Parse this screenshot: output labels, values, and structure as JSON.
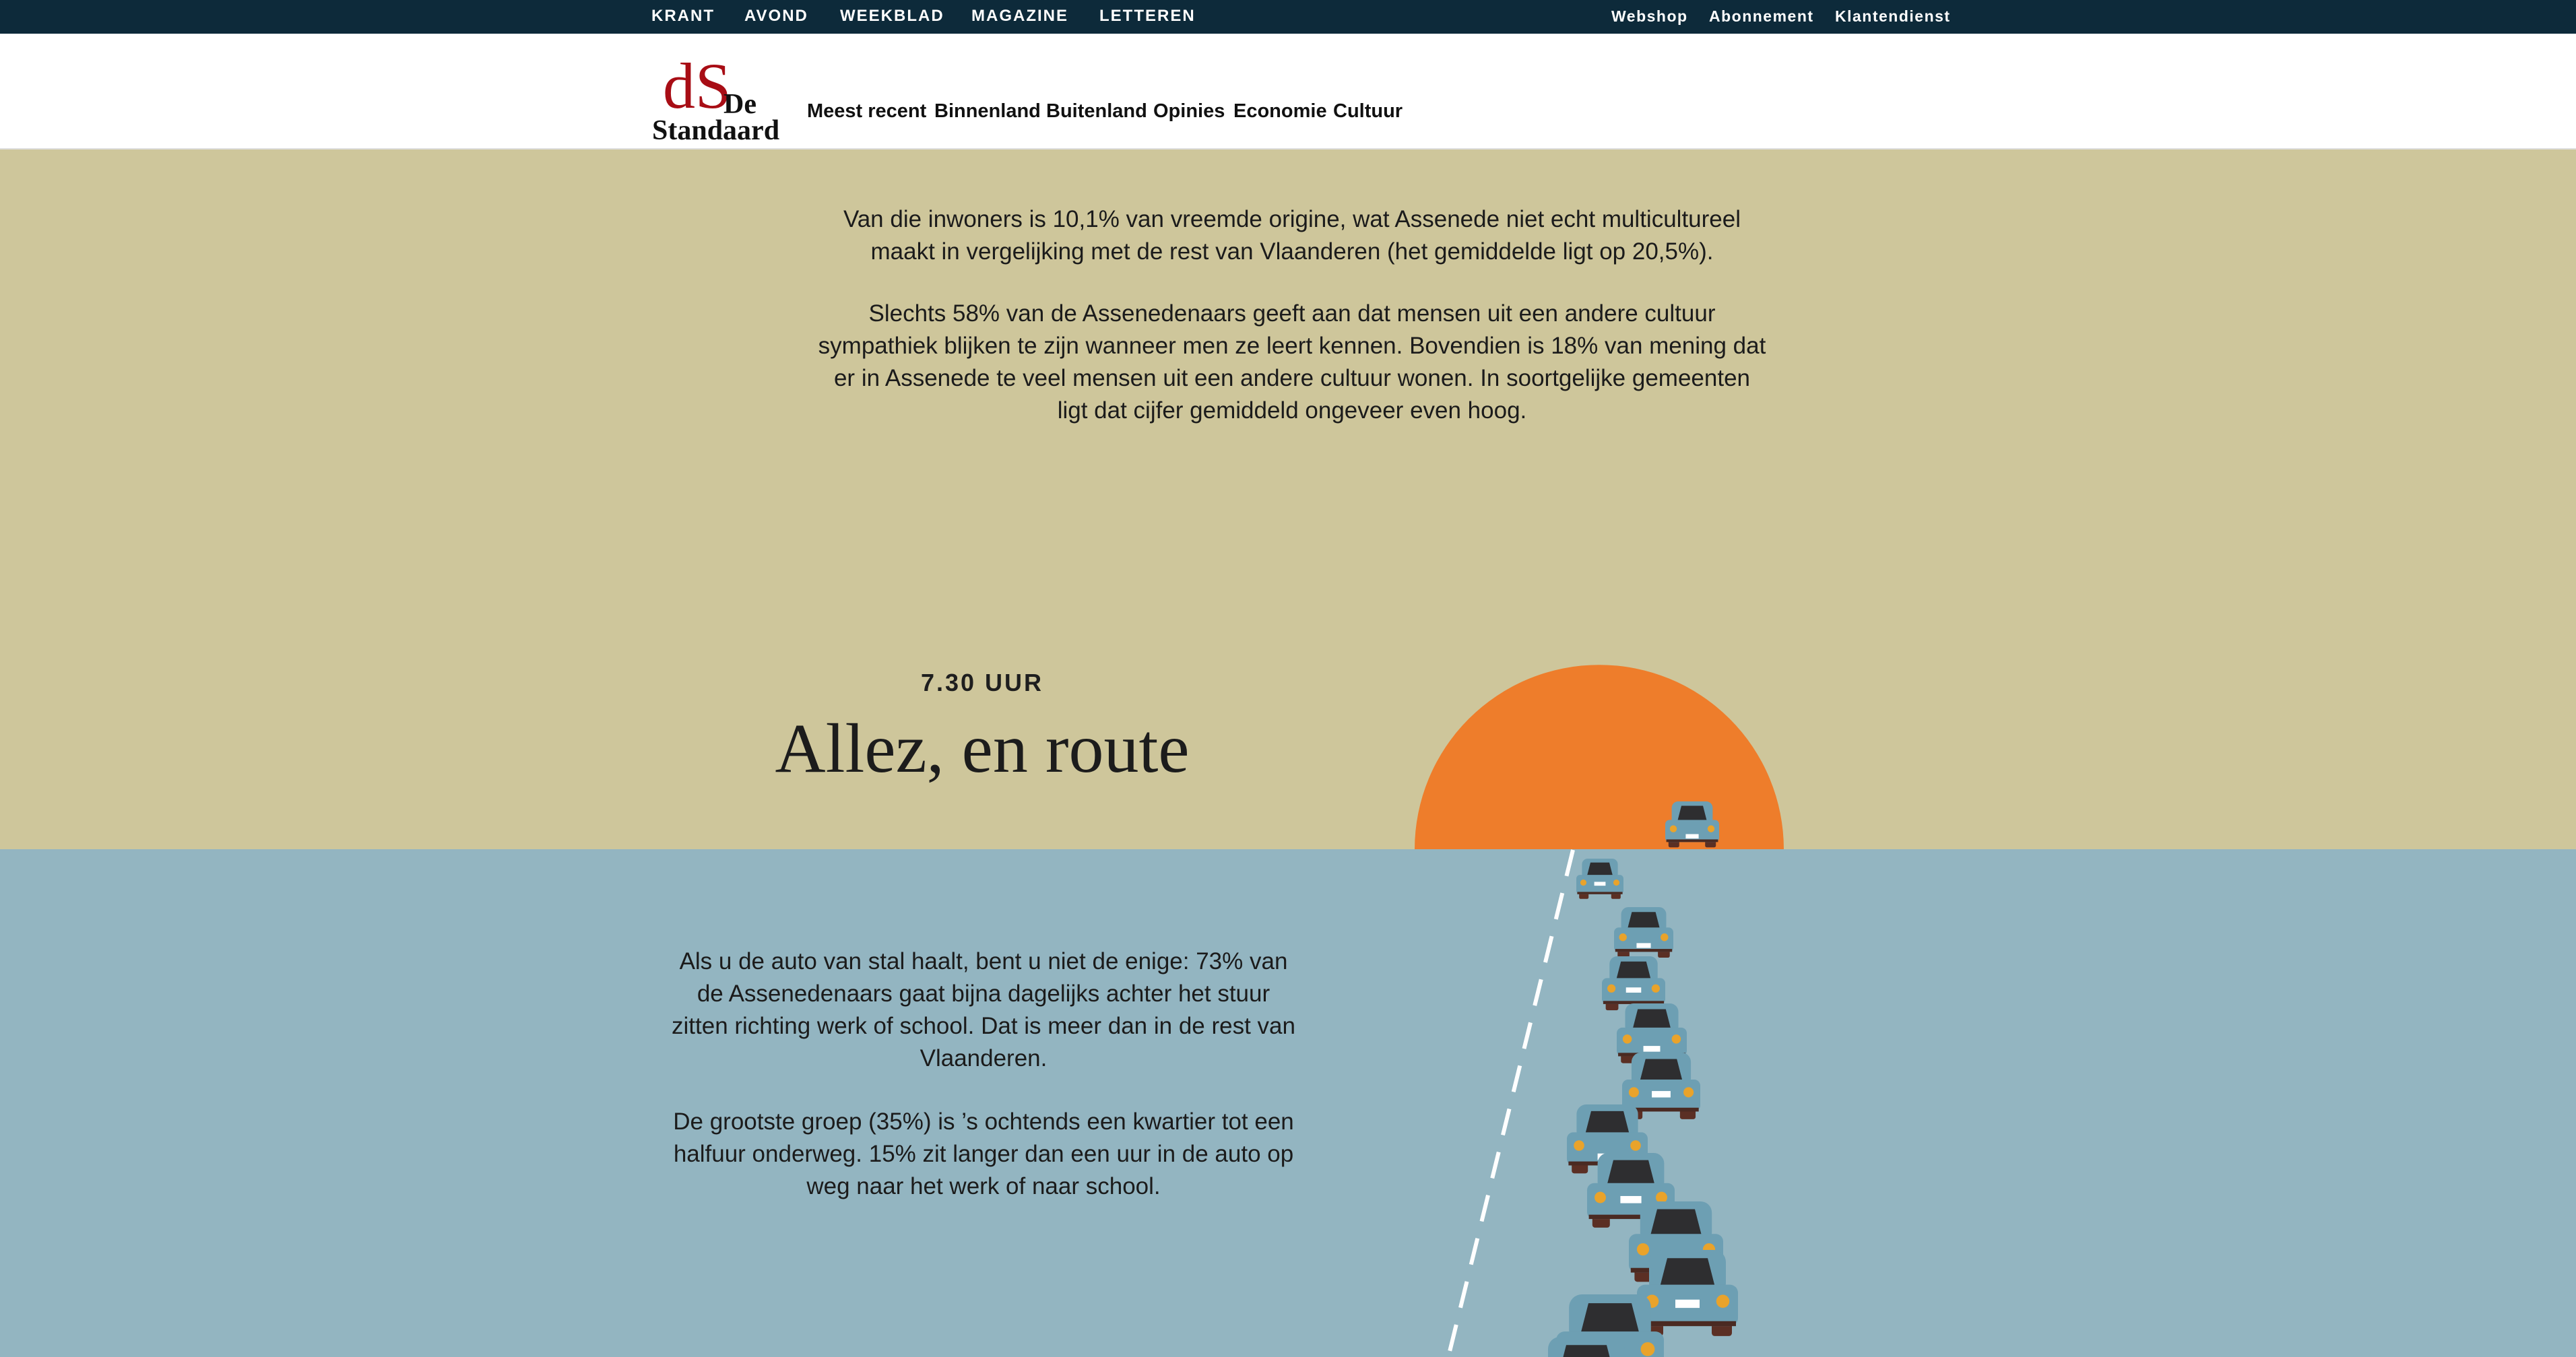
{
  "topbar": {
    "left_links": [
      "KRANT",
      "AVOND",
      "WEEKBLAD",
      "MAGAZINE",
      "LETTEREN"
    ],
    "right_links": [
      "Webshop",
      "Abonnement",
      "Klantendienst"
    ]
  },
  "logo": {
    "mark": "dS",
    "line1": "De",
    "line2": "Standaard"
  },
  "nav": [
    "Meest recent",
    "Binnenland",
    "Buitenland",
    "Opinies",
    "Economie",
    "Cultuur"
  ],
  "intro": {
    "paragraph1": "Van die inwoners is 10,1% van vreemde origine, wat Assenede niet echt multicultureel maakt in vergelijking met de rest van Vlaanderen (het gemiddelde ligt op 20,5%).",
    "paragraph2": "Slechts 58% van de Assenedenaars geeft aan dat mensen uit een andere cultuur sympathiek blijken te zijn wanneer men ze leert kennen. Bovendien is 18% van mening dat er in Assenede te veel mensen uit een andere cultuur wonen. In soortgelijke gemeenten ligt dat cijfer gemiddeld ongeveer even hoog."
  },
  "section": {
    "kicker": "7.30 UUR",
    "title": "Allez, en route",
    "paragraph1": "Als u de auto van stal haalt, bent u niet de enige: 73% van de Assenedenaars gaat bijna dagelijks achter het stuur zitten richting werk of school. Dat is meer dan in de rest van Vlaanderen.",
    "paragraph2": "De grootste groep (35%) is ’s ochtends een kwartier tot een halfuur onderweg. 15% zit langer dan een uur in de auto op weg naar het werk of naar school."
  },
  "illustration": {
    "icons": [
      "sun",
      "road",
      "car"
    ],
    "colors": {
      "sand": "#cec69b",
      "water": "#93b5c1",
      "sun": "#ee7d2b",
      "car_body": "#6d9fb3",
      "car_window": "#2e2e30",
      "headlight": "#e9a32b",
      "wheel": "#5b2f24",
      "road_line": "#ffffff"
    }
  }
}
